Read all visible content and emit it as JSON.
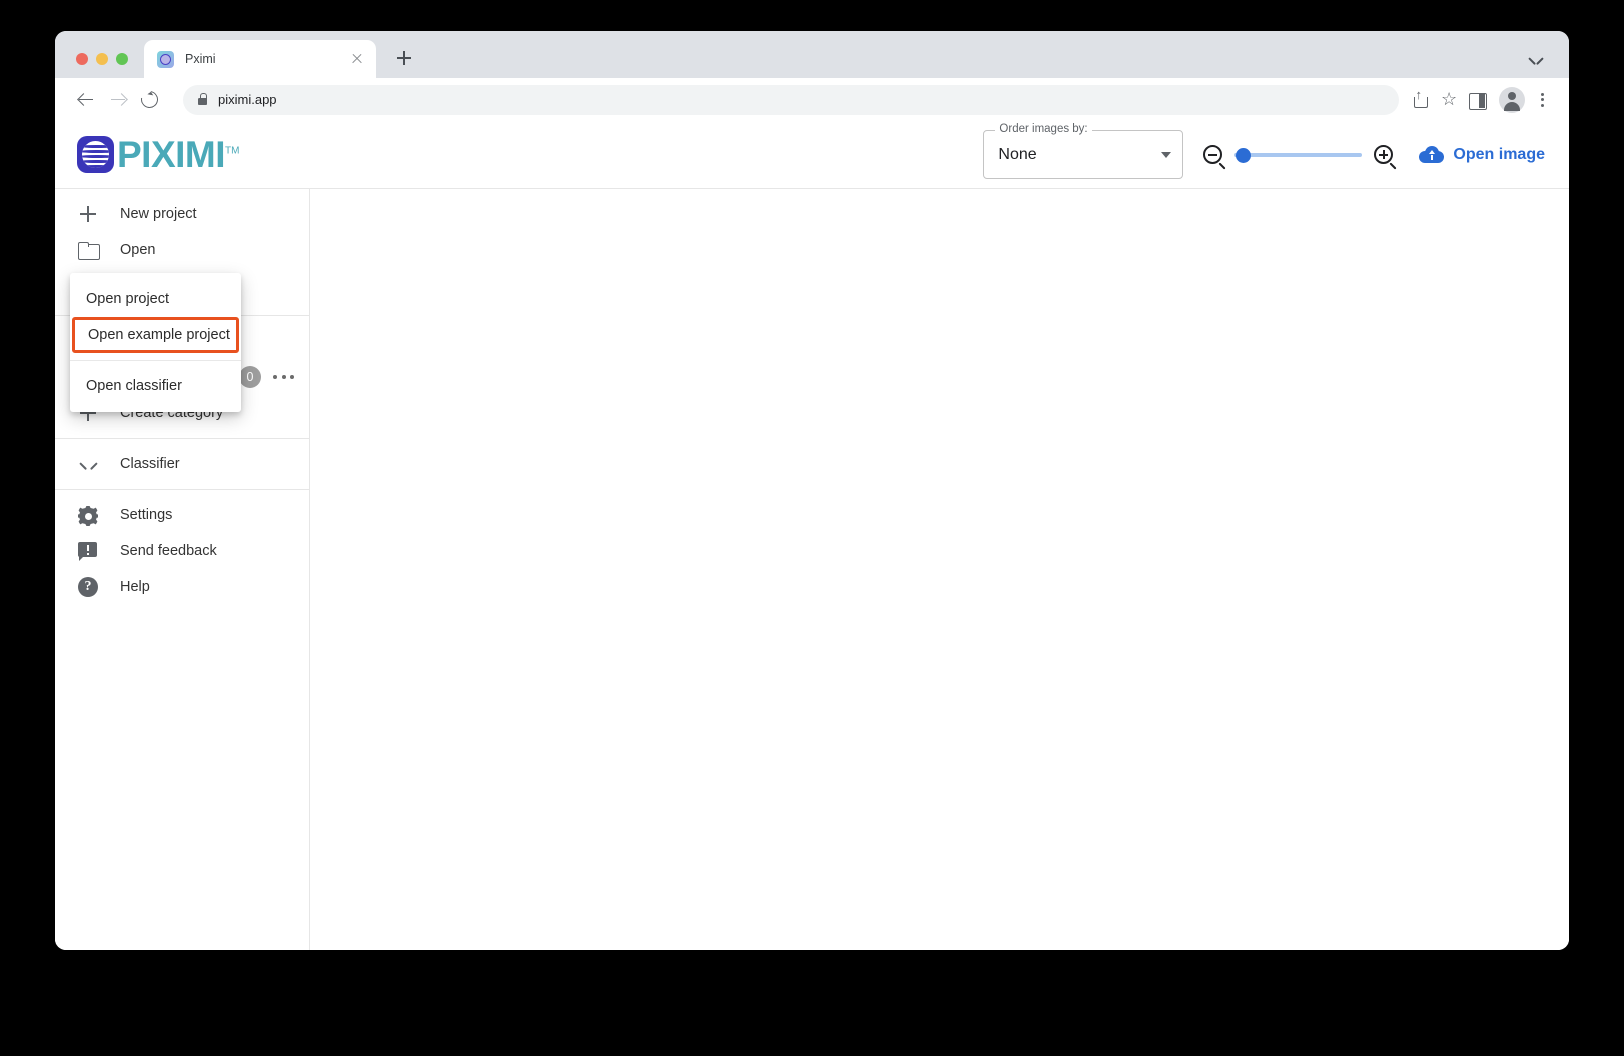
{
  "browser": {
    "tab": {
      "title": "Pximi",
      "favicon": "piximi-favicon",
      "close": "close-icon"
    },
    "new_tab": "new-tab-icon",
    "tab_list_chevron": "chevron-down-icon",
    "nav": {
      "back": "back-arrow-icon",
      "forward": "forward-arrow-icon",
      "reload": "reload-icon"
    },
    "omnibox": {
      "lock": "lock-icon",
      "url": "piximi.app"
    },
    "actions": {
      "share": "share-icon",
      "bookmark": "star-icon",
      "side_panel": "side-panel-icon",
      "profile": "avatar-icon",
      "menu": "three-dot-menu-icon"
    }
  },
  "app": {
    "logo": {
      "word": "PIXIMI",
      "tm": "TM",
      "mark": "piximi-logo-mark"
    },
    "toolbar": {
      "order_label": "Order images by:",
      "order_value": "None",
      "zoom_out_icon": "zoom-out-icon",
      "zoom_in_icon": "zoom-in-icon",
      "slider_value": 5,
      "open_image_label": "Open image",
      "open_image_icon": "cloud-upload-icon"
    }
  },
  "sidebar": {
    "project_items": [
      {
        "label": "New project",
        "icon": "plus-icon"
      },
      {
        "label": "Open",
        "icon": "folder-icon"
      }
    ],
    "category": {
      "badge": "0",
      "more": "more-options-icon"
    },
    "create_category": {
      "label": "Create category",
      "icon": "plus-icon"
    },
    "classifier": {
      "label": "Classifier",
      "icon": "chevron-down-icon"
    },
    "footer_items": [
      {
        "label": "Settings",
        "icon": "gear-icon"
      },
      {
        "label": "Send feedback",
        "icon": "feedback-icon"
      },
      {
        "label": "Help",
        "icon": "help-icon"
      }
    ]
  },
  "popup": {
    "items": [
      {
        "label": "Open project",
        "highlighted": false
      },
      {
        "label": "Open example project",
        "highlighted": true
      },
      {
        "label": "Open classifier",
        "highlighted": false
      }
    ]
  },
  "colors": {
    "brand_teal": "#4aa9b8",
    "accent_blue": "#2b6cd4",
    "highlight_orange": "#e8511f",
    "badge_grey": "#9e9e9e"
  }
}
